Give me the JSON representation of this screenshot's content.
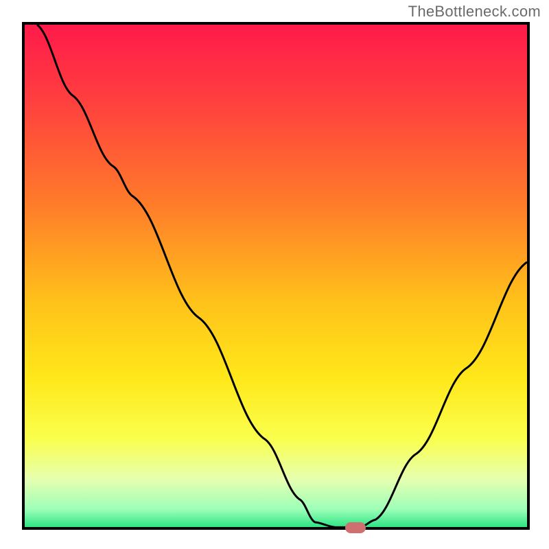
{
  "watermark": "TheBottleneck.com",
  "chart_data": {
    "type": "line",
    "title": "",
    "xlabel": "",
    "ylabel": "",
    "xlim": [
      0,
      100
    ],
    "ylim": [
      0,
      100
    ],
    "gradient_stops": [
      {
        "pos": 0.0,
        "color": "#ff1a4a"
      },
      {
        "pos": 0.15,
        "color": "#ff3f3f"
      },
      {
        "pos": 0.35,
        "color": "#ff7a2a"
      },
      {
        "pos": 0.55,
        "color": "#ffc21a"
      },
      {
        "pos": 0.7,
        "color": "#ffe81a"
      },
      {
        "pos": 0.82,
        "color": "#faff4d"
      },
      {
        "pos": 0.9,
        "color": "#e6ffb0"
      },
      {
        "pos": 0.96,
        "color": "#9cffb8"
      },
      {
        "pos": 1.0,
        "color": "#1ddf7c"
      }
    ],
    "curve_points": [
      {
        "x": 3,
        "y": 100
      },
      {
        "x": 10,
        "y": 86
      },
      {
        "x": 18,
        "y": 72
      },
      {
        "x": 22,
        "y": 66
      },
      {
        "x": 35,
        "y": 42
      },
      {
        "x": 48,
        "y": 18
      },
      {
        "x": 55,
        "y": 6
      },
      {
        "x": 58,
        "y": 1.5
      },
      {
        "x": 62,
        "y": 0.5
      },
      {
        "x": 67,
        "y": 0.5
      },
      {
        "x": 70,
        "y": 2
      },
      {
        "x": 78,
        "y": 15
      },
      {
        "x": 88,
        "y": 32
      },
      {
        "x": 100,
        "y": 53
      }
    ],
    "marker": {
      "x": 66,
      "y": 0
    }
  }
}
